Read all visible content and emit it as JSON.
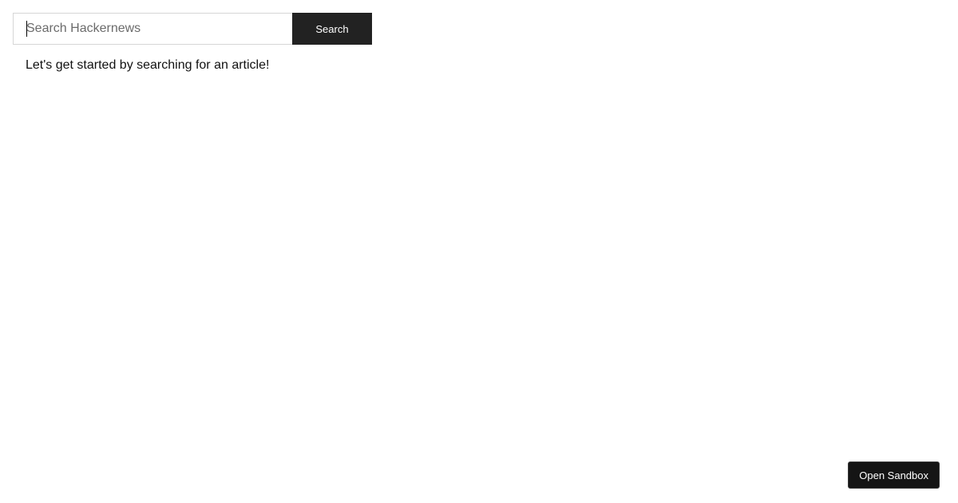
{
  "search": {
    "placeholder": "Search Hackernews",
    "value": "",
    "button_label": "Search"
  },
  "results": {
    "empty_message": "Let's get started by searching for an article!"
  },
  "sandbox": {
    "button_label": "Open Sandbox"
  }
}
